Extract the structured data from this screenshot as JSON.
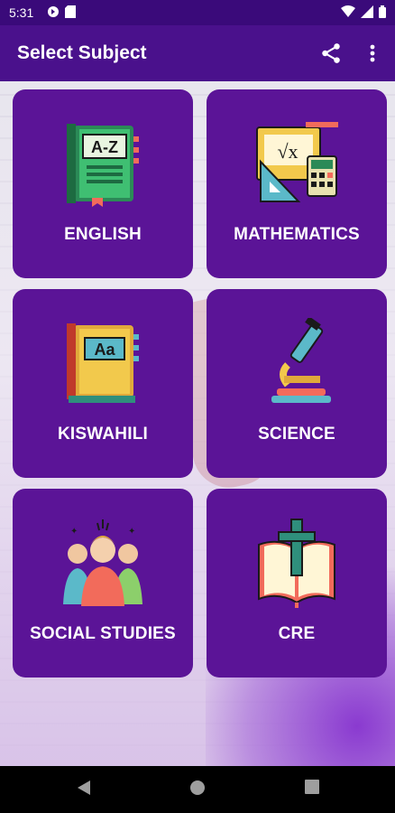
{
  "status": {
    "time": "5:31"
  },
  "app_bar": {
    "title": "Select Subject",
    "share_icon": "share-icon",
    "more_icon": "more-vert-icon"
  },
  "subjects": [
    {
      "label": "ENGLISH",
      "icon": "az-book-icon"
    },
    {
      "label": "MATHEMATICS",
      "icon": "math-tools-icon"
    },
    {
      "label": "KISWAHILI",
      "icon": "aa-book-icon"
    },
    {
      "label": "SCIENCE",
      "icon": "microscope-icon"
    },
    {
      "label": "SOCIAL STUDIES",
      "icon": "people-group-icon"
    },
    {
      "label": "CRE",
      "icon": "bible-cross-icon"
    }
  ],
  "colors": {
    "status_bar": "#3a0a7a",
    "app_bar": "#4a118c",
    "card": "#5b1497"
  }
}
